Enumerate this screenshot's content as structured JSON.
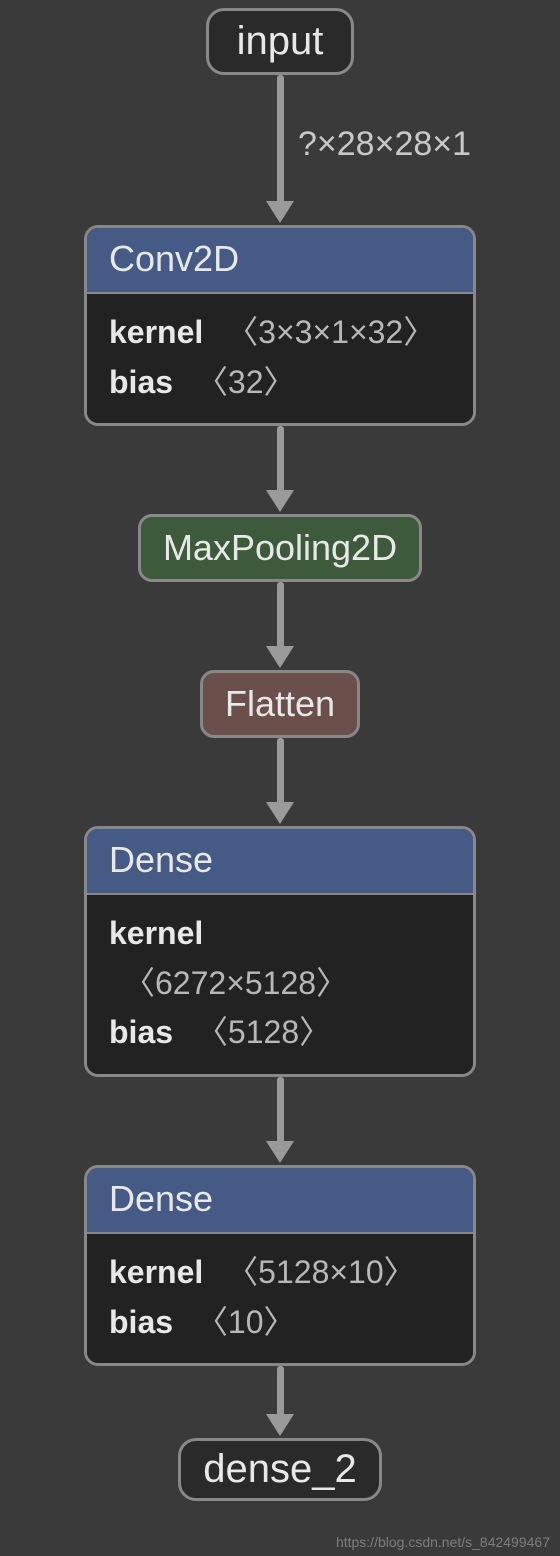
{
  "nodes": {
    "input": {
      "label": "input"
    },
    "conv2d": {
      "title": "Conv2D",
      "kernel_label": "kernel",
      "kernel_value": "〈3×3×1×32〉",
      "bias_label": "bias",
      "bias_value": "〈32〉"
    },
    "maxpool": {
      "label": "MaxPooling2D"
    },
    "flatten": {
      "label": "Flatten"
    },
    "dense1": {
      "title": "Dense",
      "kernel_label": "kernel",
      "kernel_value": "〈6272×5128〉",
      "bias_label": "bias",
      "bias_value": "〈5128〉"
    },
    "dense2": {
      "title": "Dense",
      "kernel_label": "kernel",
      "kernel_value": "〈5128×10〉",
      "bias_label": "bias",
      "bias_value": "〈10〉"
    },
    "output": {
      "label": "dense_2"
    }
  },
  "edges": {
    "input_conv": {
      "label": "?×28×28×1"
    }
  },
  "watermark": "https://blog.csdn.net/s_842499467"
}
